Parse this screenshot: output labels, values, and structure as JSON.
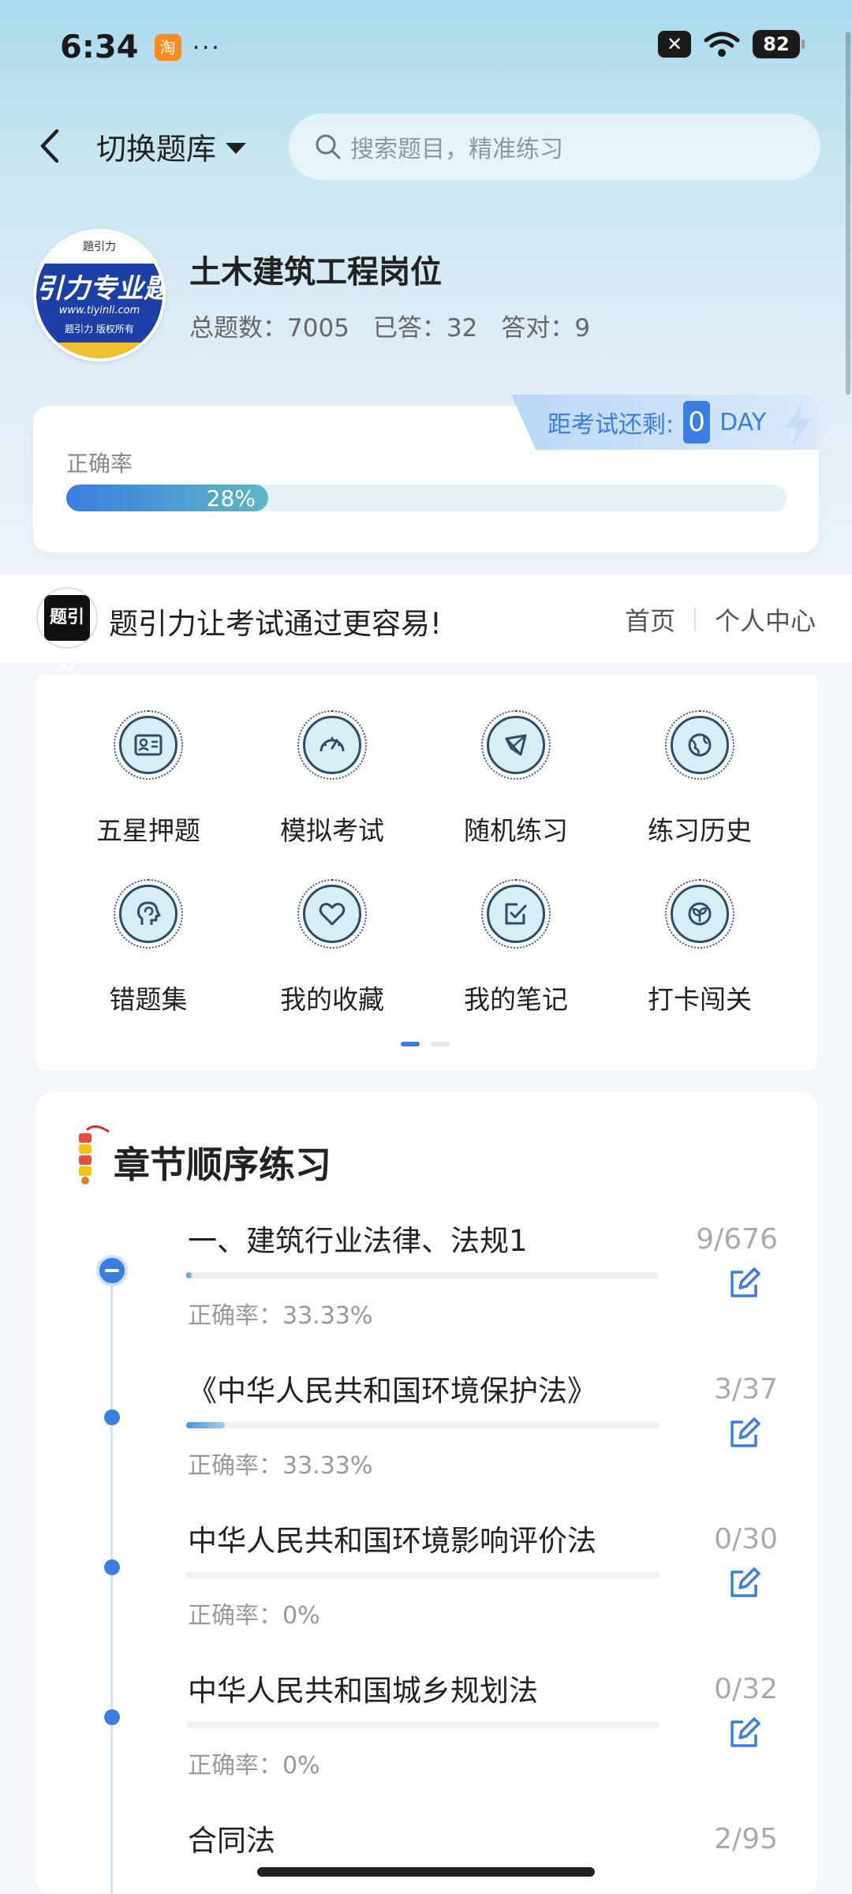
{
  "status_bar": {
    "time": "6:34",
    "app_icon": "taobao-icon",
    "more": "···",
    "battery": "82"
  },
  "header": {
    "switch_label": "切换题库",
    "search_placeholder": "搜索题目，精准练习"
  },
  "profile": {
    "logo": {
      "top": "題引力",
      "main": "引力专业题",
      "url": "www.tiyinli.com",
      "copyright": "题引力 版权所有"
    },
    "title": "土木建筑工程岗位",
    "total_label": "总题数：7005",
    "answered_label": "已答：32",
    "correct_label": "答对：9"
  },
  "accuracy_card": {
    "countdown_label": "距考试还剩:",
    "countdown_value": "0",
    "countdown_unit": "DAY",
    "label": "正确率",
    "percent_text": "28%",
    "percent_value": 28
  },
  "brand": {
    "logo_text": "题引力",
    "slogan": "题引力让考试通过更容易!",
    "nav_home": "首页",
    "nav_personal": "个人中心"
  },
  "grid": {
    "items": [
      {
        "label": "五星押题",
        "icon": "id-card-icon"
      },
      {
        "label": "模拟考试",
        "icon": "gauge-icon"
      },
      {
        "label": "随机练习",
        "icon": "compass-icon"
      },
      {
        "label": "练习历史",
        "icon": "globe-icon"
      },
      {
        "label": "错题集",
        "icon": "head-icon"
      },
      {
        "label": "我的收藏",
        "icon": "heart-icon"
      },
      {
        "label": "我的笔记",
        "icon": "note-icon"
      },
      {
        "label": "打卡闯关",
        "icon": "plant-icon"
      }
    ]
  },
  "chapters": {
    "title": "章节顺序练习",
    "items": [
      {
        "name": "一、建筑行业法律、法规1",
        "accuracy": "正确率：33.33%",
        "count": "9/676",
        "progress": 0.013
      },
      {
        "name": "《中华人民共和国环境保护法》",
        "accuracy": "正确率：33.33%",
        "count": "3/37",
        "progress": 0.081
      },
      {
        "name": "中华人民共和国环境影响评价法",
        "accuracy": "正确率：0%",
        "count": "0/30",
        "progress": 0
      },
      {
        "name": "中华人民共和国城乡规划法",
        "accuracy": "正确率：0%",
        "count": "0/32",
        "progress": 0
      },
      {
        "name": "合同法",
        "accuracy": "",
        "count": "2/95",
        "progress": 0.021
      }
    ]
  },
  "colors": {
    "accent": "#3b7de0",
    "teal": "#5fb7c6"
  }
}
